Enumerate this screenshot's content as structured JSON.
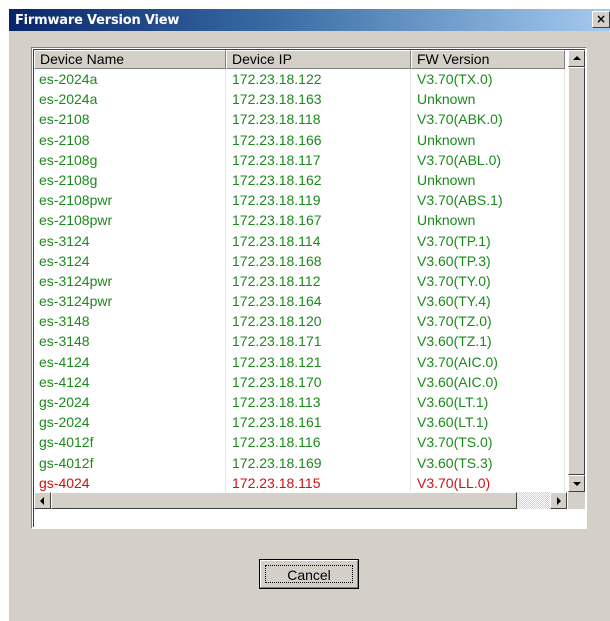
{
  "window": {
    "title": "Firmware Version View",
    "close_label": "×"
  },
  "table": {
    "columns": [
      "Device Name",
      "Device IP",
      "FW Version"
    ],
    "rows": [
      {
        "name": "es-2024a",
        "ip": "172.23.18.122",
        "fw": "V3.70(TX.0)",
        "status": "ok"
      },
      {
        "name": "es-2024a",
        "ip": "172.23.18.163",
        "fw": "Unknown",
        "status": "ok"
      },
      {
        "name": "es-2108",
        "ip": "172.23.18.118",
        "fw": "V3.70(ABK.0)",
        "status": "ok"
      },
      {
        "name": "es-2108",
        "ip": "172.23.18.166",
        "fw": "Unknown",
        "status": "ok"
      },
      {
        "name": "es-2108g",
        "ip": "172.23.18.117",
        "fw": "V3.70(ABL.0)",
        "status": "ok"
      },
      {
        "name": "es-2108g",
        "ip": "172.23.18.162",
        "fw": "Unknown",
        "status": "ok"
      },
      {
        "name": "es-2108pwr",
        "ip": "172.23.18.119",
        "fw": "V3.70(ABS.1)",
        "status": "ok"
      },
      {
        "name": "es-2108pwr",
        "ip": "172.23.18.167",
        "fw": "Unknown",
        "status": "ok"
      },
      {
        "name": "es-3124",
        "ip": "172.23.18.114",
        "fw": "V3.70(TP.1)",
        "status": "ok"
      },
      {
        "name": "es-3124",
        "ip": "172.23.18.168",
        "fw": "V3.60(TP.3)",
        "status": "ok"
      },
      {
        "name": "es-3124pwr",
        "ip": "172.23.18.112",
        "fw": "V3.70(TY.0)",
        "status": "ok"
      },
      {
        "name": "es-3124pwr",
        "ip": "172.23.18.164",
        "fw": "V3.60(TY.4)",
        "status": "ok"
      },
      {
        "name": "es-3148",
        "ip": "172.23.18.120",
        "fw": "V3.70(TZ.0)",
        "status": "ok"
      },
      {
        "name": "es-3148",
        "ip": "172.23.18.171",
        "fw": "V3.60(TZ.1)",
        "status": "ok"
      },
      {
        "name": "es-4124",
        "ip": "172.23.18.121",
        "fw": "V3.70(AIC.0)",
        "status": "ok"
      },
      {
        "name": "es-4124",
        "ip": "172.23.18.170",
        "fw": "V3.60(AIC.0)",
        "status": "ok"
      },
      {
        "name": "gs-2024",
        "ip": "172.23.18.113",
        "fw": "V3.60(LT.1)",
        "status": "ok"
      },
      {
        "name": "gs-2024",
        "ip": "172.23.18.161",
        "fw": "V3.60(LT.1)",
        "status": "ok"
      },
      {
        "name": "gs-4012f",
        "ip": "172.23.18.116",
        "fw": "V3.70(TS.0)",
        "status": "ok"
      },
      {
        "name": "gs-4012f",
        "ip": "172.23.18.169",
        "fw": "V3.60(TS.3)",
        "status": "ok"
      },
      {
        "name": "gs-4024",
        "ip": "172.23.18.115",
        "fw": "V3.70(LL.0)",
        "status": "error"
      }
    ]
  },
  "colors": {
    "ok_text": "#1b8a1b",
    "error_text": "#d01010",
    "titlebar_start": "#0a246a",
    "titlebar_end": "#a6caf0"
  },
  "buttons": {
    "cancel_label": "Cancel"
  }
}
